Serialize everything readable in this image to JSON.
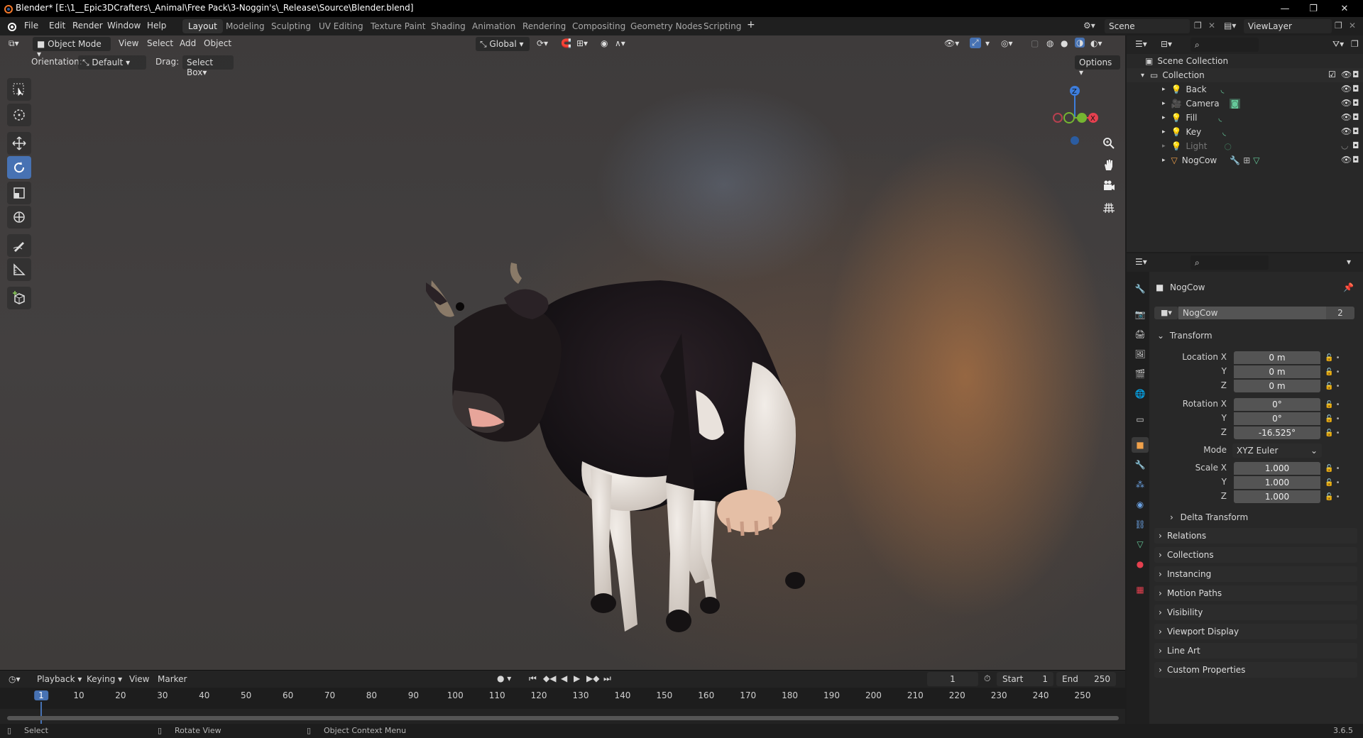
{
  "titlebar": {
    "title": "Blender* [E:\\1__Epic3DCrafters\\_Animal\\Free Pack\\3-Noggin's\\_Release\\Source\\Blender.blend]",
    "minimize": "—",
    "restore": "❐",
    "close": "✕"
  },
  "menu": {
    "file": "File",
    "edit": "Edit",
    "render": "Render",
    "window": "Window",
    "help": "Help"
  },
  "workspaces": [
    "Layout",
    "Modeling",
    "Sculpting",
    "UV Editing",
    "Texture Paint",
    "Shading",
    "Animation",
    "Rendering",
    "Compositing",
    "Geometry Nodes",
    "Scripting"
  ],
  "scene": {
    "name": "Scene",
    "viewlayer": "ViewLayer"
  },
  "header": {
    "mode": "Object Mode",
    "view": "View",
    "select": "Select",
    "add": "Add",
    "object": "Object",
    "transform_orientation": "Global"
  },
  "toolsettings": {
    "orientation_label": "Orientation:",
    "orientation_value": "Default",
    "drag_label": "Drag:",
    "drag_value": "Select Box",
    "options": "Options"
  },
  "gizmo": {
    "z": "Z",
    "x": "X",
    "y": "Y"
  },
  "outliner": {
    "scene_collection": "Scene Collection",
    "collection": "Collection",
    "items": [
      {
        "name": "Back"
      },
      {
        "name": "Camera"
      },
      {
        "name": "Fill"
      },
      {
        "name": "Key"
      },
      {
        "name": "Light"
      },
      {
        "name": "NogCow"
      }
    ]
  },
  "properties": {
    "object_name": "NogCow",
    "datablock_name": "NogCow",
    "datablock_users": "2",
    "transform_title": "Transform",
    "location": {
      "label_x": "Location X",
      "label_y": "Y",
      "label_z": "Z",
      "x": "0 m",
      "y": "0 m",
      "z": "0 m"
    },
    "rotation": {
      "label_x": "Rotation X",
      "label_y": "Y",
      "label_z": "Z",
      "x": "0°",
      "y": "0°",
      "z": "-16.525°"
    },
    "mode_label": "Mode",
    "mode_value": "XYZ Euler",
    "scale": {
      "label_x": "Scale X",
      "label_y": "Y",
      "label_z": "Z",
      "x": "1.000",
      "y": "1.000",
      "z": "1.000"
    },
    "delta_transform": "Delta Transform",
    "panels": [
      "Relations",
      "Collections",
      "Instancing",
      "Motion Paths",
      "Visibility",
      "Viewport Display",
      "Line Art",
      "Custom Properties"
    ]
  },
  "timeline": {
    "playback": "Playback",
    "keying": "Keying",
    "view": "View",
    "marker": "Marker",
    "current_frame": "1",
    "start_label": "Start",
    "start": "1",
    "end_label": "End",
    "end": "250",
    "ticks": [
      "1",
      "10",
      "20",
      "30",
      "40",
      "50",
      "60",
      "70",
      "80",
      "90",
      "100",
      "110",
      "120",
      "130",
      "140",
      "150",
      "160",
      "170",
      "180",
      "190",
      "200",
      "210",
      "220",
      "230",
      "240",
      "250"
    ]
  },
  "statusbar": {
    "select": "Select",
    "rotate": "Rotate View",
    "context": "Object Context Menu",
    "version": "3.6.5"
  },
  "colors": {
    "accent": "#4772b3",
    "axis_x": "#e5404f",
    "axis_y": "#75b531",
    "axis_z": "#3d7ddc",
    "active_item": "#f0a14a"
  }
}
